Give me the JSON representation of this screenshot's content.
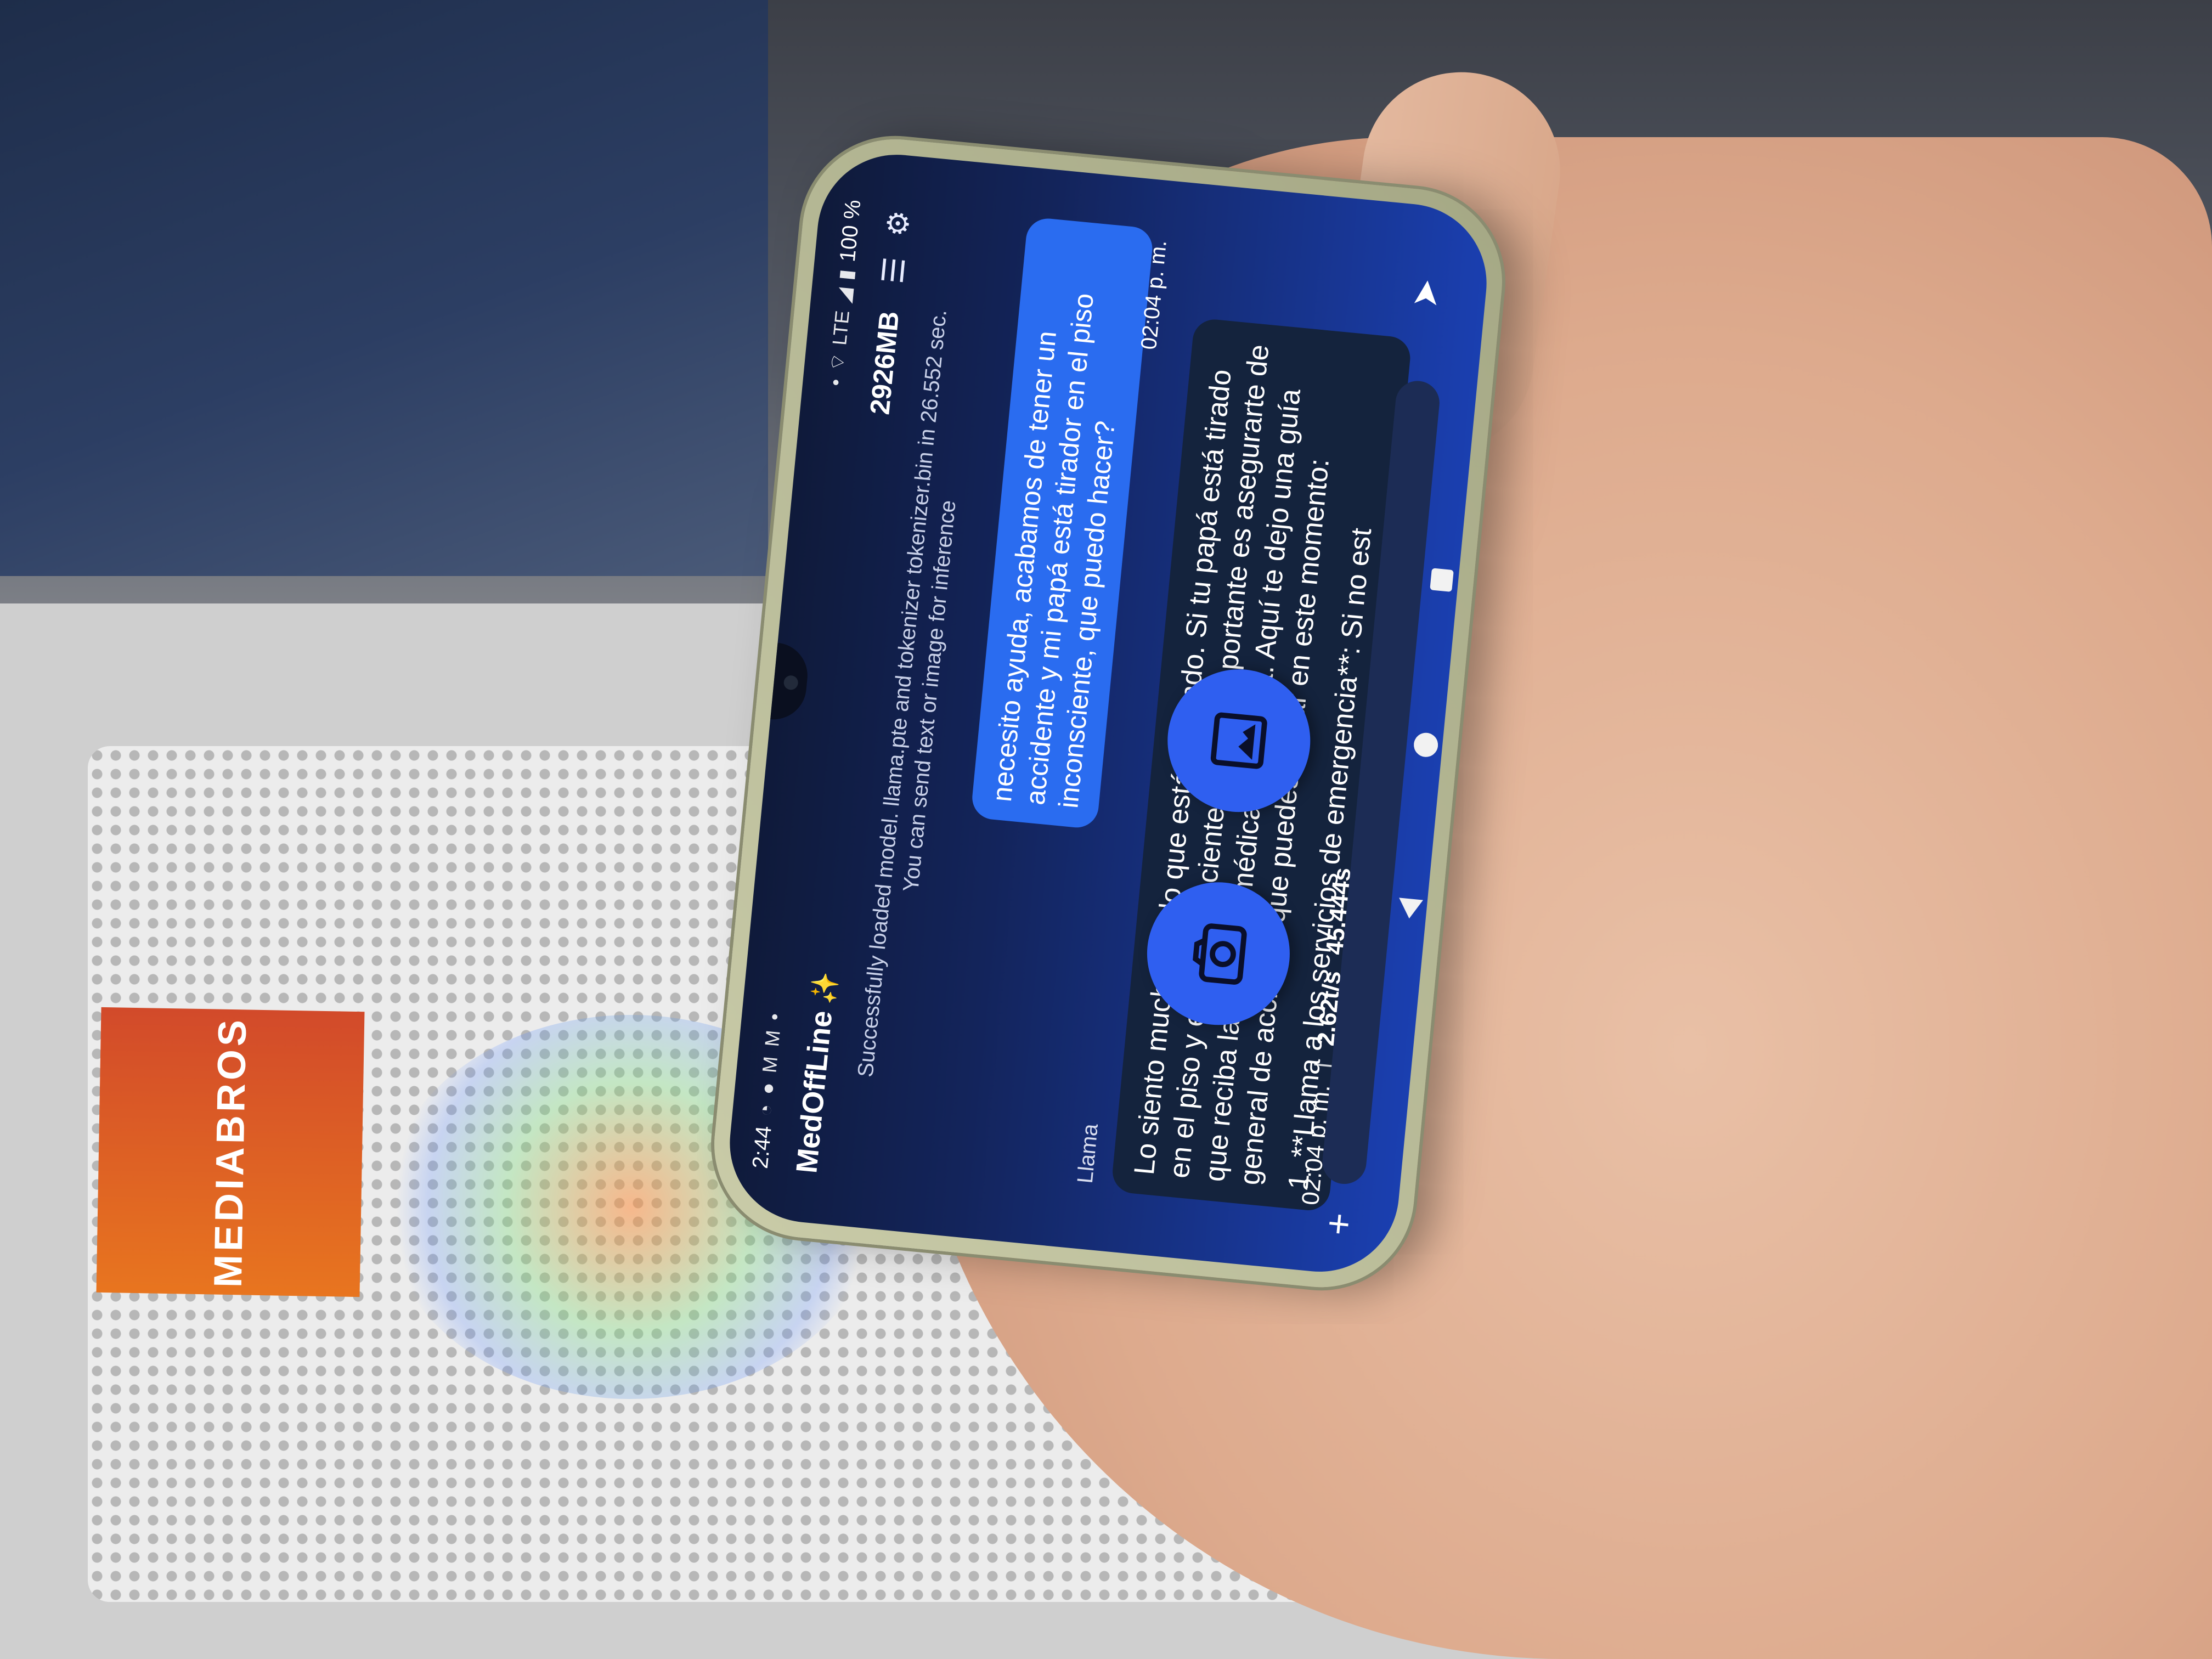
{
  "status_bar": {
    "time": "2:44",
    "network": "LTE",
    "battery": "100 %"
  },
  "header": {
    "app_title": "MedOffLine",
    "sparkle_icon": "sparkles-icon",
    "memory": "2926MB",
    "notes_icon": "list-icon",
    "settings_icon": "gear-icon"
  },
  "system_message": "Successfully loaded model. llama.pte and tokenizer tokenizer.bin in 26.552 sec. You can send text or image for inference",
  "messages": [
    {
      "role": "user",
      "text": "necesito ayuda, acabamos de tener un accidente y mi papá está tirador en el piso inconsciente, que puedo hacer?",
      "time": "02:04 p. m."
    },
    {
      "role": "assistant",
      "sender": "Llama",
      "paragraphs": [
        "Lo siento mucho por lo que está pasando. Si tu papá está tirado en el piso y está inconsciente, lo más importante es asegurarte de que reciba la atención médica inmediata. Aquí te dejo una guía general de acciones que puedes tomar en este momento:",
        "1. **Llama a los servicios de emergencia**: Si no est"
      ],
      "time": "02:04 p. m.",
      "tokens_per_sec": "2.62t/s",
      "duration": "45.444s"
    }
  ],
  "input": {
    "value": "",
    "placeholder": ""
  },
  "background": {
    "box_brand": "MEDIABROS"
  }
}
